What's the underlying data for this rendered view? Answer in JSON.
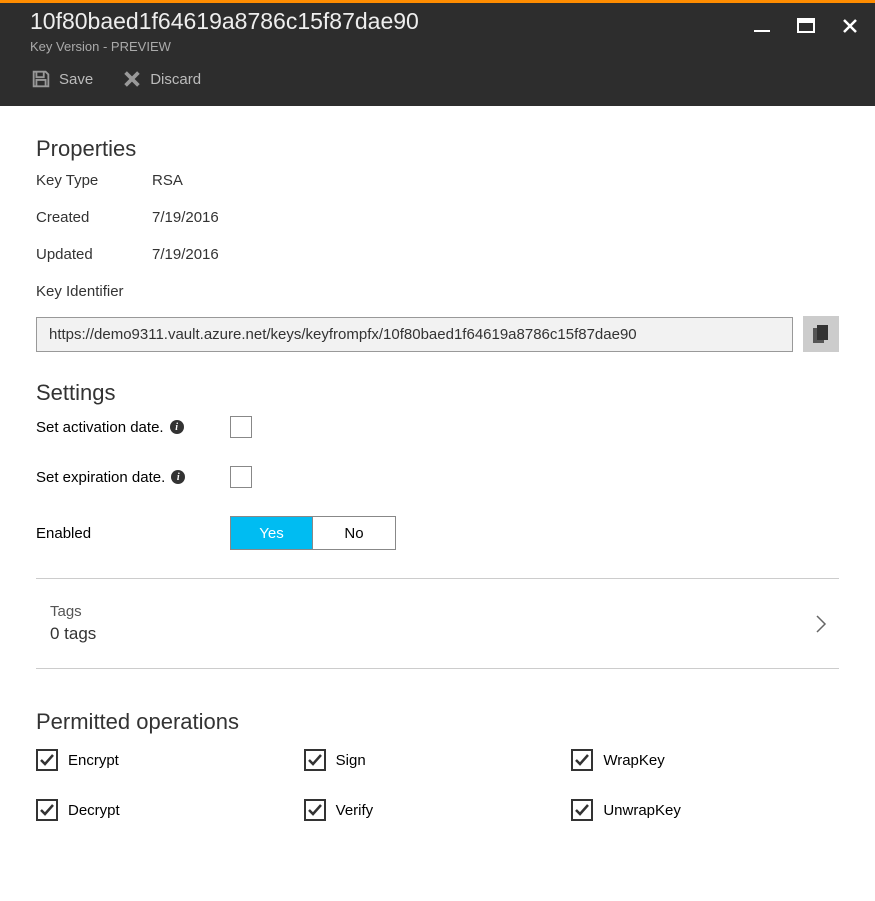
{
  "header": {
    "title": "10f80baed1f64619a8786c15f87dae90",
    "subtitle": "Key Version - PREVIEW"
  },
  "toolbar": {
    "save": "Save",
    "discard": "Discard"
  },
  "properties": {
    "section_title": "Properties",
    "key_type_label": "Key Type",
    "key_type_value": "RSA",
    "created_label": "Created",
    "created_value": "7/19/2016",
    "updated_label": "Updated",
    "updated_value": "7/19/2016",
    "key_id_label": "Key Identifier",
    "key_id_value": "https://demo9311.vault.azure.net/keys/keyfrompfx/10f80baed1f64619a8786c15f87dae90"
  },
  "settings": {
    "section_title": "Settings",
    "activation_label": "Set activation date.",
    "expiration_label": "Set expiration date.",
    "enabled_label": "Enabled",
    "yes": "Yes",
    "no": "No"
  },
  "tags": {
    "label": "Tags",
    "count": "0 tags"
  },
  "operations": {
    "section_title": "Permitted operations",
    "encrypt": "Encrypt",
    "sign": "Sign",
    "wrapkey": "WrapKey",
    "decrypt": "Decrypt",
    "verify": "Verify",
    "unwrapkey": "UnwrapKey"
  }
}
